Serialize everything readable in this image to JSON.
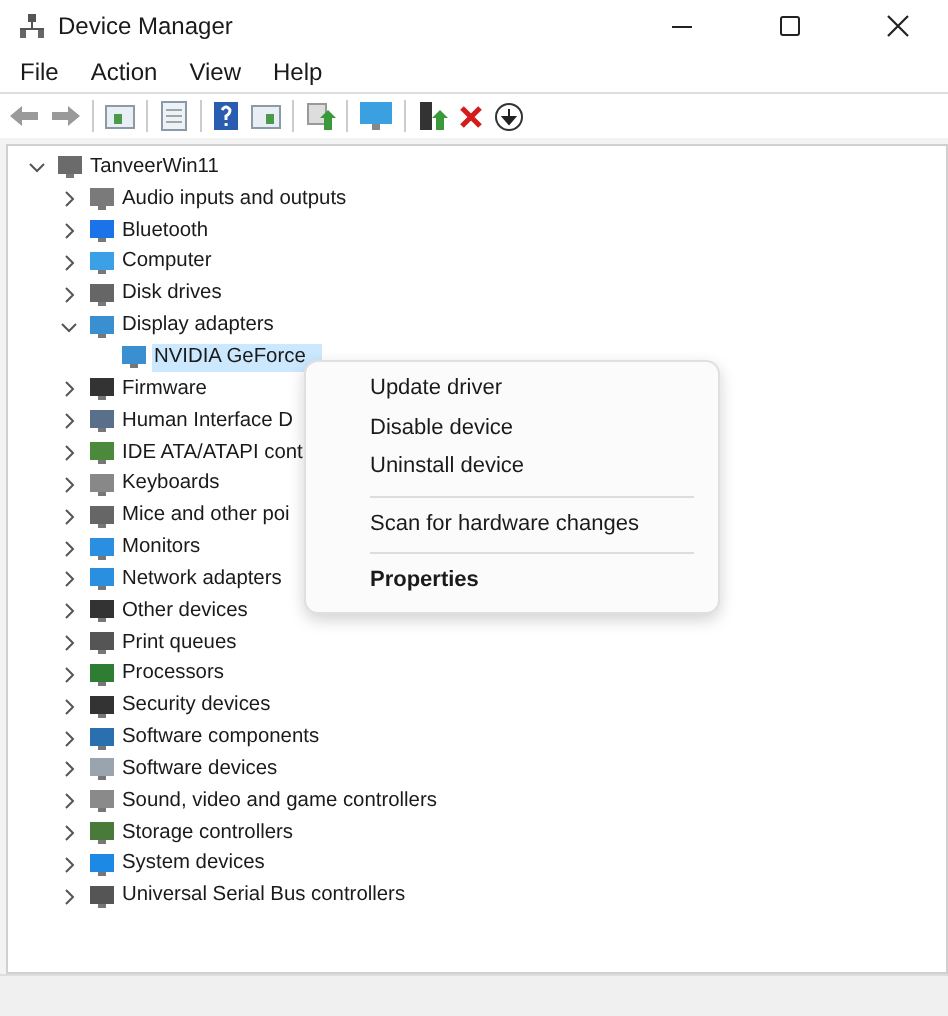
{
  "window": {
    "title": "Device Manager"
  },
  "menu_bar": [
    "File",
    "Action",
    "View",
    "Help"
  ],
  "tree": [
    {
      "label": "TanveerWin11",
      "expanded": true,
      "selected": false,
      "children": [
        {
          "label": "Audio inputs and outputs",
          "expanded": false,
          "selected": false
        },
        {
          "label": "Bluetooth",
          "expanded": false,
          "selected": false
        },
        {
          "label": "Computer",
          "expanded": false,
          "selected": false
        },
        {
          "label": "Disk drives",
          "expanded": false,
          "selected": false
        },
        {
          "label": "Display adapters",
          "expanded": true,
          "selected": false,
          "children": [
            {
              "label": "NVIDIA GeForce",
              "selected": true
            }
          ]
        },
        {
          "label": "Firmware",
          "expanded": false,
          "selected": false
        },
        {
          "label": "Human Interface D",
          "expanded": false,
          "selected": false
        },
        {
          "label": "IDE ATA/ATAPI cont",
          "expanded": false,
          "selected": false
        },
        {
          "label": "Keyboards",
          "expanded": false,
          "selected": false
        },
        {
          "label": "Mice and other poi",
          "expanded": false,
          "selected": false
        },
        {
          "label": "Monitors",
          "expanded": false,
          "selected": false
        },
        {
          "label": "Network adapters",
          "expanded": false,
          "selected": false
        },
        {
          "label": "Other devices",
          "expanded": false,
          "selected": false
        },
        {
          "label": "Print queues",
          "expanded": false,
          "selected": false
        },
        {
          "label": "Processors",
          "expanded": false,
          "selected": false
        },
        {
          "label": "Security devices",
          "expanded": false,
          "selected": false
        },
        {
          "label": "Software components",
          "expanded": false,
          "selected": false
        },
        {
          "label": "Software devices",
          "expanded": false,
          "selected": false
        },
        {
          "label": "Sound, video and game controllers",
          "expanded": false,
          "selected": false
        },
        {
          "label": "Storage controllers",
          "expanded": false,
          "selected": false
        },
        {
          "label": "System devices",
          "expanded": false,
          "selected": false
        },
        {
          "label": "Universal Serial Bus controllers",
          "expanded": false,
          "selected": false
        }
      ]
    }
  ],
  "context_menu": [
    {
      "kind": "item",
      "label": "Update driver"
    },
    {
      "kind": "item",
      "label": "Disable device"
    },
    {
      "kind": "item",
      "label": "Uninstall device"
    },
    {
      "kind": "separator"
    },
    {
      "kind": "item",
      "label": "Scan for hardware changes"
    },
    {
      "kind": "separator"
    },
    {
      "kind": "default",
      "label": "Properties"
    }
  ]
}
